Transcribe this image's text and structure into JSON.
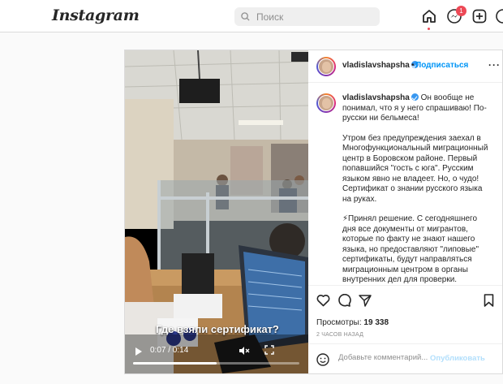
{
  "app": {
    "logo": "Instagram"
  },
  "search": {
    "placeholder": "Поиск"
  },
  "nav": {
    "notifications_count": "1"
  },
  "post": {
    "username": "vladislavshapsha",
    "follow_label": "Подписаться",
    "dot": "•",
    "more_label": "···",
    "caption_paragraphs": [
      "Он вообще не понимал, что я у него спрашиваю! По-русски ни бельмеса!",
      "Утром без предупреждения заехал в Многофункциональный миграционный центр в Боровском районе. Первый попавшийся \"гость с юга\". Русским языком явно не владеет. Но, о чудо! Сертификат о знании русского языка на руках.",
      "⚡Принял решение. С сегодняшнего дня все документы от мигрантов, которые по факту не знают нашего языка, но предоставляют \"липовые\" сертификаты, будут направляться миграционным центром в органы внутренних дел для проверки."
    ],
    "video": {
      "overlay_caption": "Где взяли сертификат?",
      "time": "0:07 / 0:14",
      "progress": 0.5
    },
    "views_label": "Просмотры:",
    "views_count": "19 338",
    "time_ago": "2 ЧАСОВ НАЗАД",
    "comment_placeholder": "Добавьте комментарий...",
    "publish_label": "Опубликовать"
  },
  "colors": {
    "accent": "#0095f6",
    "badge": "#ed4956"
  }
}
